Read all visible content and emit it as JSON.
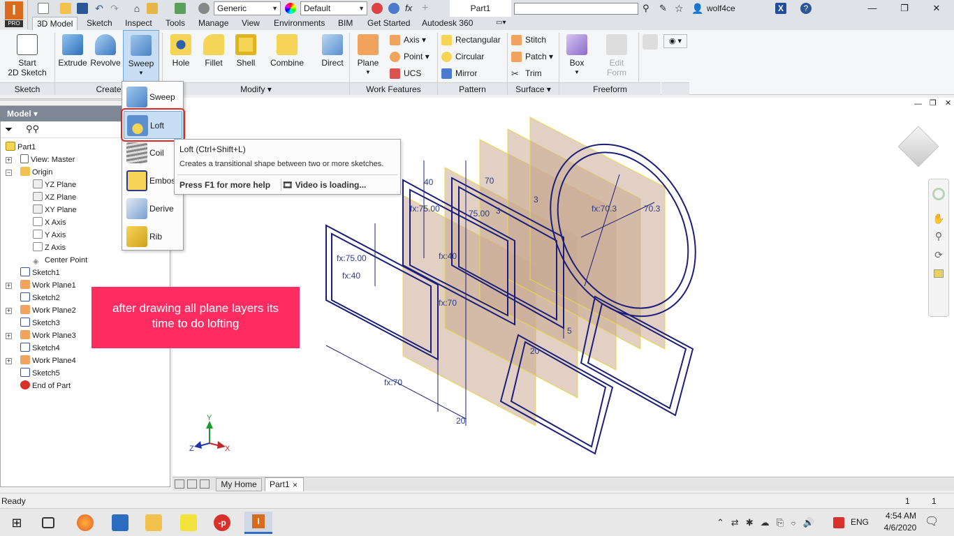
{
  "app": {
    "logo_letter": "I",
    "edition": "PRO"
  },
  "quick_access": {
    "material_combo": "Generic",
    "appearance_combo": "Default",
    "fx_label": "fx",
    "document_title": "Part1",
    "search_placeholder": "",
    "user_name": "wolf4ce",
    "help_label": "?"
  },
  "tabs": [
    {
      "label": "3D Model",
      "active": true
    },
    {
      "label": "Sketch"
    },
    {
      "label": "Inspect"
    },
    {
      "label": "Tools"
    },
    {
      "label": "Manage"
    },
    {
      "label": "View"
    },
    {
      "label": "Environments"
    },
    {
      "label": "BIM"
    },
    {
      "label": "Get Started"
    },
    {
      "label": "Autodesk 360"
    }
  ],
  "ribbon": {
    "start_sketch_1": "Start",
    "start_sketch_2": "2D Sketch",
    "extrude": "Extrude",
    "revolve": "Revolve",
    "sweep": "Sweep",
    "hole": "Hole",
    "fillet": "Fillet",
    "shell": "Shell",
    "combine": "Combine",
    "direct": "Direct",
    "plane": "Plane",
    "axis": "Axis",
    "point": "Point",
    "ucs": "UCS",
    "rectangular": "Rectangular",
    "circular": "Circular",
    "mirror": "Mirror",
    "stitch": "Stitch",
    "patch": "Patch",
    "trim": "Trim",
    "box": "Box",
    "edit_form_1": "Edit",
    "edit_form_2": "Form",
    "groups": {
      "sketch": "Sketch",
      "create": "Create",
      "modify": "Modify",
      "work_features": "Work Features",
      "pattern": "Pattern",
      "surface": "Surface",
      "freeform": "Freeform"
    }
  },
  "browser": {
    "header": "Model",
    "tree": [
      {
        "label": "Part1"
      },
      {
        "label": "View: Master"
      },
      {
        "label": "Origin"
      },
      {
        "label": "YZ Plane"
      },
      {
        "label": "XZ Plane"
      },
      {
        "label": "XY Plane"
      },
      {
        "label": "X Axis"
      },
      {
        "label": "Y Axis"
      },
      {
        "label": "Z Axis"
      },
      {
        "label": "Center Point"
      },
      {
        "label": "Sketch1"
      },
      {
        "label": "Work Plane1"
      },
      {
        "label": "Sketch2"
      },
      {
        "label": "Work Plane2"
      },
      {
        "label": "Sketch3"
      },
      {
        "label": "Work Plane3"
      },
      {
        "label": "Sketch4"
      },
      {
        "label": "Work Plane4"
      },
      {
        "label": "Sketch5"
      },
      {
        "label": "End of Part"
      }
    ]
  },
  "dropdown": {
    "items": [
      {
        "label": "Sweep"
      },
      {
        "label": "Loft",
        "selected": true
      },
      {
        "label": "Coil"
      },
      {
        "label": "Emboss"
      },
      {
        "label": "Derive"
      },
      {
        "label": "Rib"
      }
    ]
  },
  "tooltip": {
    "title": "Loft",
    "shortcut": "(Ctrl+Shift+L)",
    "description": "Creates a transitional shape between two or more sketches.",
    "help": "Press F1 for more help",
    "video": "Video is loading..."
  },
  "callout": {
    "text": "after drawing all plane layers its time to do lofting",
    "color": "#ff2c62"
  },
  "viewport": {
    "dims": {
      "d1": "40",
      "d2": "70",
      "d3": "fx:75.00",
      "d4": "75.00",
      "d5": "fx:70.3",
      "d6": "70.3",
      "d7": "fx:40",
      "d8": "fx:70",
      "d9": "fx:75.00",
      "d10": "fx:40",
      "d11": "fx:70",
      "d12": "20",
      "d13": "20",
      "d14": "5",
      "d15": "3",
      "d16": "3"
    },
    "triad": {
      "x": "X",
      "y": "Y",
      "z": "Z"
    }
  },
  "doc_tabs": {
    "home": "My Home",
    "part": "Part1"
  },
  "status": {
    "left": "Ready",
    "n1": "1",
    "n2": "1"
  },
  "taskbar": {
    "lang": "ENG",
    "time": "4:54 AM",
    "date": "4/6/2020"
  },
  "colors": {
    "accent": "#2b3a8c",
    "plane_fill": "#c9a992",
    "select_blue": "#c7def5",
    "highlight_red": "#e02424"
  }
}
